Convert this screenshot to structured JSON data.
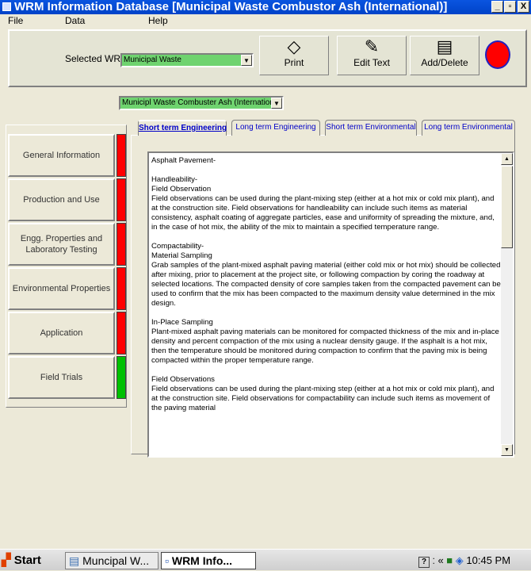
{
  "window": {
    "title": "WRM Information Database [Municipal Waste Combustor Ash (International)]",
    "minimize_glyph": "_",
    "maximize_glyph": "▫",
    "close_glyph": "X"
  },
  "menu": [
    "File",
    "Data",
    "Help"
  ],
  "toolbar": {
    "selected_label": "Selected  WRM >",
    "wrm_select_value": "Municipal Waste",
    "sub_select_value": "Municipl Waste Combuster Ash (International)",
    "buttons": [
      {
        "label": "Print",
        "icon": "◇"
      },
      {
        "label": "Edit Text",
        "icon": "✎"
      },
      {
        "label": "Add/Delete",
        "icon": "▤"
      }
    ],
    "status_color": "#ff0000"
  },
  "sidebar": {
    "items": [
      {
        "label": "General Information",
        "flag_color": "#ff0000"
      },
      {
        "label": "Production and Use",
        "flag_color": "#ff0000"
      },
      {
        "label": "Engg. Properties and Laboratory Testing",
        "flag_color": "#ff0000"
      },
      {
        "label": "Environmental Properties",
        "flag_color": "#ff0000"
      },
      {
        "label": "Application",
        "flag_color": "#ff0000"
      },
      {
        "label": "Field Trials",
        "flag_color": "#00c000"
      }
    ]
  },
  "tabs": [
    {
      "label": "Short term Engineering",
      "active": true
    },
    {
      "label": "Long term Engineering",
      "active": false
    },
    {
      "label": "Short term Environmental",
      "active": false
    },
    {
      "label": "Long term Environmental",
      "active": false
    }
  ],
  "content": {
    "paragraphs": [
      "Asphalt Pavement-",
      "Handleability-\nField Observation\nField observations can be used during the plant-mixing step (either at a hot mix or cold mix plant), and at the construction site. Field observations for handleability can include such items as material consistency, asphalt coating of aggregate particles, ease and uniformity of spreading the mixture, and, in the case of hot mix, the ability of the mix to maintain a specified temperature range.",
      "Compactability-\nMaterial Sampling\nGrab samples of the plant-mixed asphalt paving material (either cold mix or hot mix) should be collected after mixing, prior to placement at the project site, or following compaction by coring the roadway at selected locations. The compacted density of core samples taken from the compacted pavement can be used to confirm that the mix has been compacted to the maximum density value determined in the mix design.",
      "In-Place Sampling\nPlant-mixed asphalt paving materials can be monitored for compacted thickness of the mix and in-place density and percent compaction of the mix using a nuclear density gauge. If the asphalt is a hot mix, then the temperature should be monitored during compaction to confirm that the paving mix is being compacted within the proper temperature range.",
      "Field Observations\nField observations can be used during the plant-mixing step (either at a hot mix or cold mix plant), and at the construction site. Field observations for compactability can include such items as movement of the paving material"
    ]
  },
  "taskbar": {
    "start_label": "Start",
    "tasks": [
      {
        "label": "Muncipal W...",
        "active": false
      },
      {
        "label": "WRM Info...",
        "active": true
      }
    ],
    "clock": "10:45 PM"
  }
}
